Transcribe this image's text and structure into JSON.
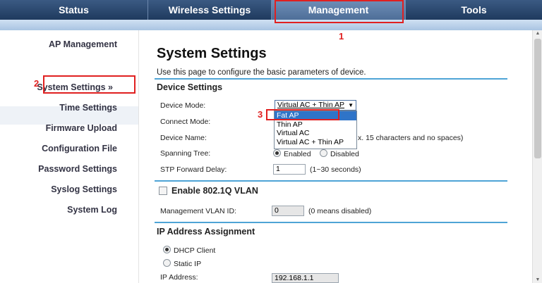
{
  "nav": {
    "status": "Status",
    "wireless": "Wireless Settings",
    "management": "Management",
    "tools": "Tools"
  },
  "markers": {
    "one": "1",
    "two": "2",
    "three": "3"
  },
  "sidebar": {
    "items": [
      "AP Management",
      "System Settings »",
      "Time Settings",
      "Firmware Upload",
      "Configuration File",
      "Password Settings",
      "Syslog Settings",
      "System Log"
    ]
  },
  "main": {
    "title": "System Settings",
    "desc": "Use this page to configure the basic parameters of device.",
    "device_settings": "Device Settings",
    "device_mode_label": "Device Mode:",
    "device_mode_value": "Virtual AC + Thin AP",
    "dropdown_options": [
      "Fat AP",
      "Thin AP",
      "Virtual AC",
      "Virtual AC + Thin AP"
    ],
    "connect_mode_label": "Connect Mode:",
    "device_name_label": "Device Name:",
    "device_name_hint": "x. 15 characters and no spaces)",
    "spanning_tree_label": "Spanning Tree:",
    "enabled": "Enabled",
    "disabled": "Disabled",
    "stp_label": "STP Forward Delay:",
    "stp_value": "1",
    "stp_hint": "(1~30 seconds)",
    "vlan_title": "Enable 802.1Q VLAN",
    "mgmt_vlan_label": "Management VLAN ID:",
    "mgmt_vlan_value": "0",
    "mgmt_vlan_hint": "(0 means disabled)",
    "ip_title": "IP Address Assignment",
    "dhcp": "DHCP Client",
    "static": "Static IP",
    "ip_label": "IP Address:",
    "ip_value": "192.168.1.1"
  }
}
